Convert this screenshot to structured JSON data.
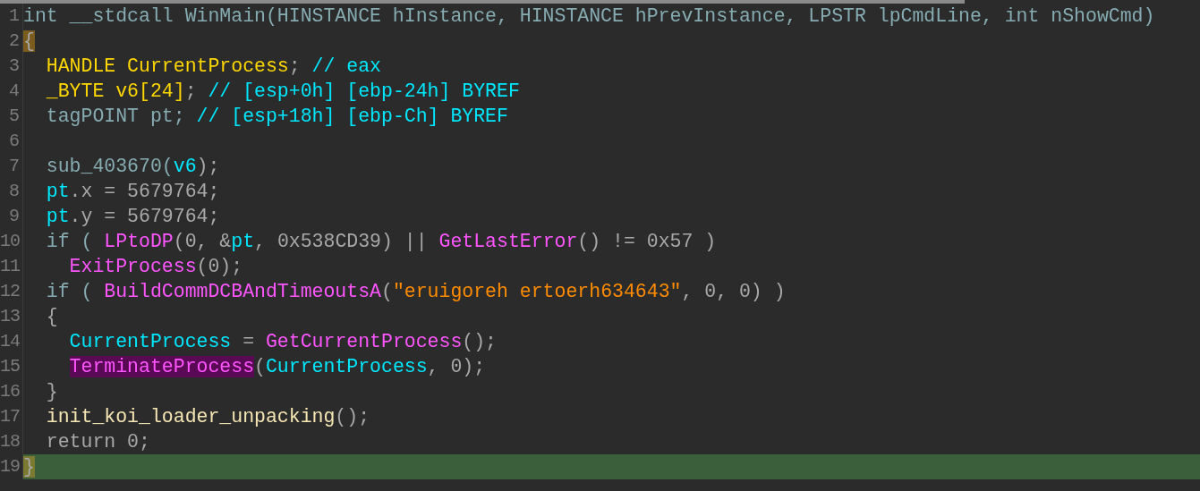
{
  "lines": [
    {
      "number": "1",
      "current": false,
      "tokens": [
        {
          "text": "int __stdcall WinMain(HINSTANCE hInstance, HINSTANCE hPrevInstance, LPSTR lpCmdLine, int nShowCmd)",
          "kind": "kw",
          "highlighted": false
        }
      ]
    },
    {
      "number": "2",
      "current": false,
      "tokens": [
        {
          "text": "{",
          "kind": "plain",
          "highlighted": true
        }
      ]
    },
    {
      "number": "3",
      "current": false,
      "tokens": [
        {
          "text": "  HANDLE CurrentProcess",
          "kind": "type",
          "highlighted": false
        },
        {
          "text": "; ",
          "kind": "plain",
          "highlighted": false
        },
        {
          "text": "// eax",
          "kind": "comment",
          "highlighted": false
        }
      ]
    },
    {
      "number": "4",
      "current": false,
      "tokens": [
        {
          "text": "  _BYTE v6[24]",
          "kind": "type",
          "highlighted": false
        },
        {
          "text": "; ",
          "kind": "plain",
          "highlighted": false
        },
        {
          "text": "// [esp+0h] [ebp-24h] BYREF",
          "kind": "comment",
          "highlighted": false
        }
      ]
    },
    {
      "number": "5",
      "current": false,
      "tokens": [
        {
          "text": "  tagPOINT pt; ",
          "kind": "kw",
          "highlighted": false
        },
        {
          "text": "// [esp+18h] [ebp-Ch] BYREF",
          "kind": "comment",
          "highlighted": false
        }
      ]
    },
    {
      "number": "6",
      "current": false
    },
    {
      "number": "7",
      "current": false,
      "tokens": [
        {
          "text": "  sub_403670(",
          "kind": "kw",
          "highlighted": false
        },
        {
          "text": "v6",
          "kind": "var",
          "highlighted": false
        },
        {
          "text": ");",
          "kind": "plain",
          "highlighted": false
        }
      ]
    },
    {
      "number": "8",
      "current": false,
      "tokens": [
        {
          "text": "  pt",
          "kind": "var",
          "highlighted": false
        },
        {
          "text": ".x = 5679764;",
          "kind": "plain",
          "highlighted": false
        }
      ]
    },
    {
      "number": "9",
      "current": false,
      "tokens": [
        {
          "text": "  pt",
          "kind": "var",
          "highlighted": false
        },
        {
          "text": ".y = 5679764;",
          "kind": "plain",
          "highlighted": false
        }
      ]
    },
    {
      "number": "10",
      "current": false,
      "tokens": [
        {
          "text": "  if ( ",
          "kind": "kw",
          "highlighted": false
        },
        {
          "text": "LPtoDP",
          "kind": "func",
          "highlighted": false
        },
        {
          "text": "(0, &",
          "kind": "plain",
          "highlighted": false
        },
        {
          "text": "pt",
          "kind": "var",
          "highlighted": false
        },
        {
          "text": ", 0x538CD39) || ",
          "kind": "plain",
          "highlighted": false
        },
        {
          "text": "GetLastError",
          "kind": "func",
          "highlighted": false
        },
        {
          "text": "() != 0x57 )",
          "kind": "plain",
          "highlighted": false
        }
      ]
    },
    {
      "number": "11",
      "current": false,
      "tokens": [
        {
          "text": "    ExitProcess",
          "kind": "func",
          "highlighted": false
        },
        {
          "text": "(0);",
          "kind": "plain",
          "highlighted": false
        }
      ]
    },
    {
      "number": "12",
      "current": false,
      "tokens": [
        {
          "text": "  if ( ",
          "kind": "kw",
          "highlighted": false
        },
        {
          "text": "BuildCommDCBAndTimeoutsA",
          "kind": "func",
          "highlighted": false
        },
        {
          "text": "(",
          "kind": "plain",
          "highlighted": false
        },
        {
          "text": "\"eruigoreh ertoerh634643\"",
          "kind": "str",
          "highlighted": false
        },
        {
          "text": ", 0, 0) )",
          "kind": "plain",
          "highlighted": false
        }
      ]
    },
    {
      "number": "13",
      "current": false,
      "tokens": [
        {
          "text": "  {",
          "kind": "plain",
          "highlighted": false
        }
      ]
    },
    {
      "number": "14",
      "current": false,
      "tokens": [
        {
          "text": "    CurrentProcess",
          "kind": "var",
          "highlighted": false
        },
        {
          "text": " = ",
          "kind": "plain",
          "highlighted": false
        },
        {
          "text": "GetCurrentProcess",
          "kind": "func",
          "highlighted": false
        },
        {
          "text": "();",
          "kind": "plain",
          "highlighted": false
        }
      ]
    },
    {
      "number": "15",
      "current": false,
      "tokens": [
        {
          "text": "    TerminateProcess",
          "kind": "func",
          "highlighted": true
        },
        {
          "text": "(",
          "kind": "plain",
          "highlighted": false
        },
        {
          "text": "CurrentProcess",
          "kind": "var",
          "highlighted": false
        },
        {
          "text": ", 0);",
          "kind": "plain",
          "highlighted": false
        }
      ]
    },
    {
      "number": "16",
      "current": false,
      "tokens": [
        {
          "text": "  }",
          "kind": "plain",
          "highlighted": false
        }
      ]
    },
    {
      "number": "17",
      "current": false,
      "tokens": [
        {
          "text": "  init_koi_loader_unpacking",
          "kind": "user",
          "highlighted": false
        },
        {
          "text": "();",
          "kind": "plain",
          "highlighted": false
        }
      ]
    },
    {
      "number": "18",
      "current": false,
      "tokens": [
        {
          "text": "  return 0;",
          "kind": "plain",
          "highlighted": false
        }
      ]
    },
    {
      "number": "19",
      "current": true,
      "tokens": [
        {
          "text": "}",
          "kind": "plain",
          "highlighted": true
        }
      ]
    }
  ]
}
